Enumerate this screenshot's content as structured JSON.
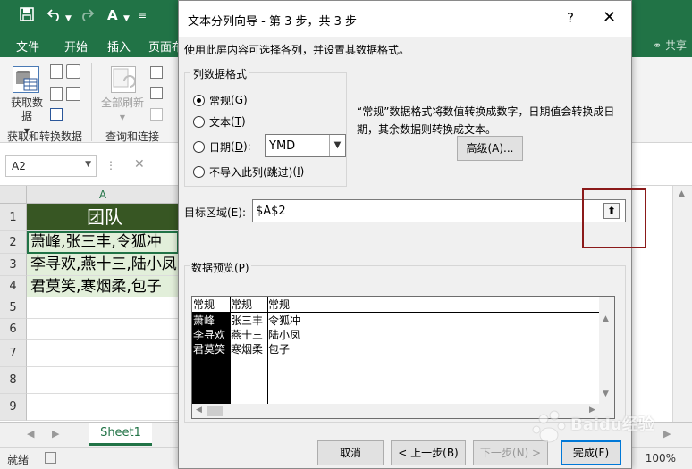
{
  "excel": {
    "qat_icons": [
      "save-icon",
      "undo-icon",
      "redo-icon",
      "font-color-icon",
      "customize-icon"
    ],
    "tabs": [
      "文件",
      "开始",
      "插入",
      "页面布"
    ],
    "share": "共享",
    "ribbon": {
      "get_data_label": "获取数据",
      "group_get_transform": "获取和转换数据",
      "refresh_all_label": "全部刷新",
      "group_queries": "查询和连接"
    },
    "name_box": "A2",
    "column_header": "A",
    "rows": [
      {
        "num": "1",
        "text": "团队"
      },
      {
        "num": "2",
        "text": "萧峰,张三丰,令狐冲"
      },
      {
        "num": "3",
        "text": "李寻欢,燕十三,陆小凤"
      },
      {
        "num": "4",
        "text": "君莫笑,寒烟柔,包子"
      },
      {
        "num": "5",
        "text": ""
      },
      {
        "num": "6",
        "text": ""
      },
      {
        "num": "7",
        "text": ""
      },
      {
        "num": "8",
        "text": ""
      },
      {
        "num": "9",
        "text": ""
      }
    ],
    "sheet_tab": "Sheet1",
    "status": "就绪",
    "zoom": "100%"
  },
  "dialog": {
    "title": "文本分列向导 - 第 3 步，共 3 步",
    "help": "?",
    "close": "✕",
    "instruction": "使用此屏内容可选择各列，并设置其数据格式。",
    "format_group_label": "列数据格式",
    "options": [
      {
        "label": "常规",
        "key": "G",
        "selected": true
      },
      {
        "label": "文本",
        "key": "T",
        "selected": false
      },
      {
        "label": "日期",
        "key": "D",
        "selected": false
      },
      {
        "label": "不导入此列(跳过)",
        "key": "I",
        "selected": false
      }
    ],
    "date_format": "YMD",
    "description": "“常规”数据格式将数值转换成数字，日期值会转换成日期，其余数据则转换成文本。",
    "advanced_label": "高级(A)...",
    "target_label": "目标区域(E):",
    "target_value": "$A$2",
    "preview_label": "数据预览(P)",
    "preview": {
      "headers": [
        "常规",
        "常规",
        "常规"
      ],
      "rows": [
        [
          "萧峰",
          "张三丰",
          "令狐冲"
        ],
        [
          "李寻欢",
          "燕十三",
          "陆小凤"
        ],
        [
          "君莫笑",
          "寒烟柔",
          "包子"
        ]
      ]
    },
    "buttons": {
      "cancel": "取消",
      "back": "< 上一步(B)",
      "next": "下一步(N) >",
      "finish": "完成(F)"
    }
  },
  "watermark": "Baidu经验"
}
